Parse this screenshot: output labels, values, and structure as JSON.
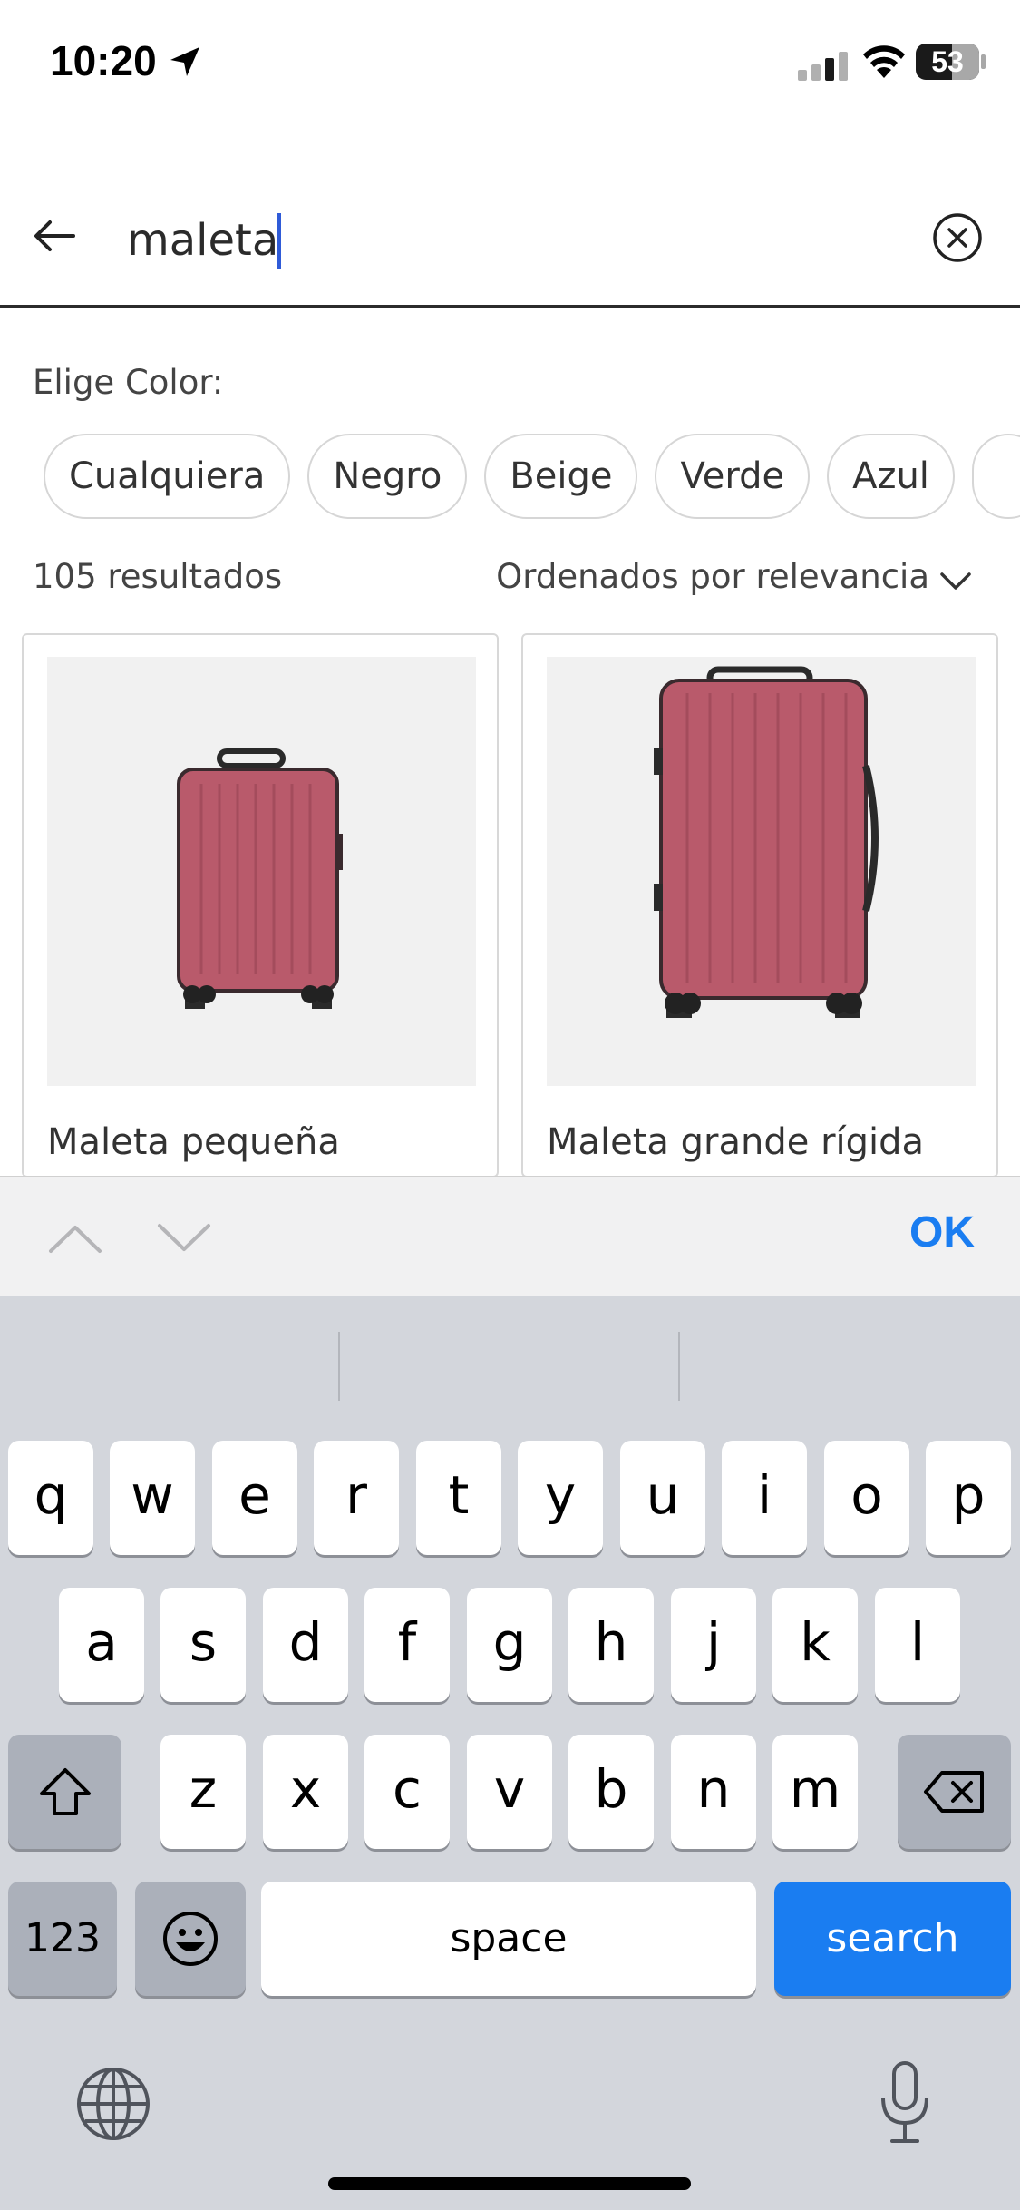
{
  "status_bar": {
    "time": "10:20",
    "battery": "53",
    "battery_level": 0.53
  },
  "search": {
    "value": "maleta",
    "back_icon": "arrow-left-icon",
    "clear_icon": "circle-x-icon"
  },
  "filters": {
    "label": "Elige Color:",
    "chips": [
      "Cualquiera",
      "Negro",
      "Beige",
      "Verde",
      "Azul",
      ""
    ]
  },
  "results": {
    "count_label": "105 resultados",
    "sort_label": "Ordenados por relevancia"
  },
  "products": [
    {
      "name": "Maleta pequeña",
      "color": "#b95a6b"
    },
    {
      "name": "Maleta grande rígida",
      "color": "#b95a6b"
    }
  ],
  "accessory_bar": {
    "ok_label": "OK"
  },
  "keyboard": {
    "row1": [
      "q",
      "w",
      "e",
      "r",
      "t",
      "y",
      "u",
      "i",
      "o",
      "p"
    ],
    "row2": [
      "a",
      "s",
      "d",
      "f",
      "g",
      "h",
      "j",
      "k",
      "l"
    ],
    "row3": [
      "z",
      "x",
      "c",
      "v",
      "b",
      "n",
      "m"
    ],
    "numbers_label": "123",
    "space_label": "space",
    "search_label": "search",
    "accent": "#1a7df1"
  }
}
